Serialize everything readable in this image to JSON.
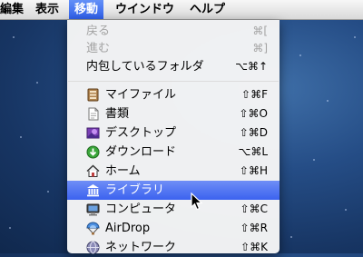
{
  "menubar": {
    "items": [
      {
        "label": "編集"
      },
      {
        "label": "表示"
      },
      {
        "label": "移動"
      },
      {
        "label": "ウインドウ"
      },
      {
        "label": "ヘルプ"
      }
    ]
  },
  "go_menu": {
    "items": [
      {
        "label": "戻る",
        "shortcut": "⌘[",
        "enabled": false
      },
      {
        "label": "進む",
        "shortcut": "⌘]",
        "enabled": false
      },
      {
        "label": "内包しているフォルダ",
        "shortcut": "⌥⌘↑",
        "enabled": true
      },
      {
        "label": "マイファイル",
        "shortcut": "⇧⌘F",
        "icon": "all-my-files-icon"
      },
      {
        "label": "書類",
        "shortcut": "⇧⌘O",
        "icon": "documents-icon"
      },
      {
        "label": "デスクトップ",
        "shortcut": "⇧⌘D",
        "icon": "desktop-icon"
      },
      {
        "label": "ダウンロード",
        "shortcut": "⌥⌘L",
        "icon": "downloads-icon"
      },
      {
        "label": "ホーム",
        "shortcut": "⇧⌘H",
        "icon": "home-icon"
      },
      {
        "label": "ライブラリ",
        "shortcut": "",
        "icon": "library-icon",
        "selected": true
      },
      {
        "label": "コンピュータ",
        "shortcut": "⇧⌘C",
        "icon": "computer-icon"
      },
      {
        "label": "AirDrop",
        "shortcut": "⇧⌘R",
        "icon": "airdrop-icon"
      },
      {
        "label": "ネットワーク",
        "shortcut": "⇧⌘K",
        "icon": "network-icon"
      }
    ]
  },
  "colors": {
    "menu_highlight": "#3b62ef",
    "desktop": "#254d86"
  }
}
